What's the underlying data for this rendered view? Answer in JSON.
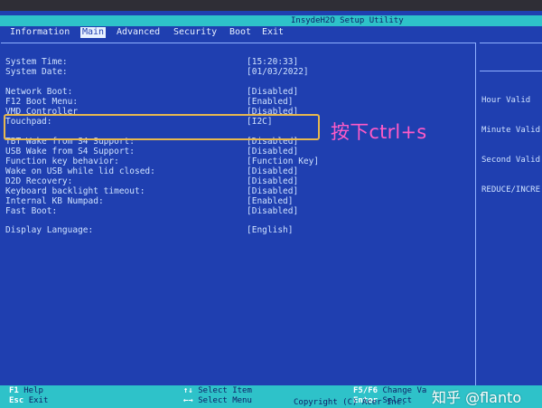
{
  "header": {
    "title": "InsydeH2O Setup Utility"
  },
  "tabs": [
    {
      "label": "Information"
    },
    {
      "label": "Main",
      "active": true
    },
    {
      "label": "Advanced"
    },
    {
      "label": "Security"
    },
    {
      "label": "Boot"
    },
    {
      "label": "Exit"
    }
  ],
  "settings": [
    {
      "label": "System Time:",
      "value": "[15:20:33]"
    },
    {
      "label": "System Date:",
      "value": "[01/03/2022]"
    },
    {
      "label": "Network Boot:",
      "value": "[Disabled]"
    },
    {
      "label": "F12 Boot Menu:",
      "value": "[Enabled]"
    },
    {
      "label": "VMD Controller",
      "value": "[Disabled]"
    },
    {
      "label": "Touchpad:",
      "value": "[I2C]"
    },
    {
      "label": "TBT Wake from S4 Support:",
      "value": "[Disabled]"
    },
    {
      "label": "USB Wake from S4 Support:",
      "value": "[Disabled]"
    },
    {
      "label": "Function key behavior:",
      "value": "[Function Key]"
    },
    {
      "label": "Wake on USB while lid closed:",
      "value": "[Disabled]"
    },
    {
      "label": "D2D Recovery:",
      "value": "[Disabled]"
    },
    {
      "label": "Keyboard backlight timeout:",
      "value": "[Disabled]"
    },
    {
      "label": "Internal KB Numpad:",
      "value": "[Enabled]"
    },
    {
      "label": "Fast Boot:",
      "value": "[Disabled]"
    },
    {
      "label": "Display Language:",
      "value": "[English]"
    }
  ],
  "help": {
    "lines": [
      "Hour Valid",
      "Minute Valid",
      "Second Valid",
      "REDUCE/INCRE"
    ]
  },
  "annotation": {
    "text": "按下ctrl+s"
  },
  "footer": {
    "f1_key": "F1",
    "f1_label": "Help",
    "esc_key": "Esc",
    "esc_label": "Exit",
    "updown_key": "↑↓",
    "updown_label": "Select Item",
    "leftright_key": "←→",
    "leftright_label": "Select Menu",
    "f5f6_key": "F5/F6",
    "f5f6_label": "Change Va",
    "enter_key": "Enter",
    "enter_label": "Select",
    "copyright": "Copyright (C) Acer Inc."
  },
  "watermark": {
    "text": "知乎 @flanto"
  },
  "colors": {
    "screen_bg": "#1f3fb0",
    "bar_cyan": "#2ec2c9",
    "text": "#cfe2ff",
    "highlight": "#e7b84e",
    "annotation": "#ff5bc7"
  }
}
